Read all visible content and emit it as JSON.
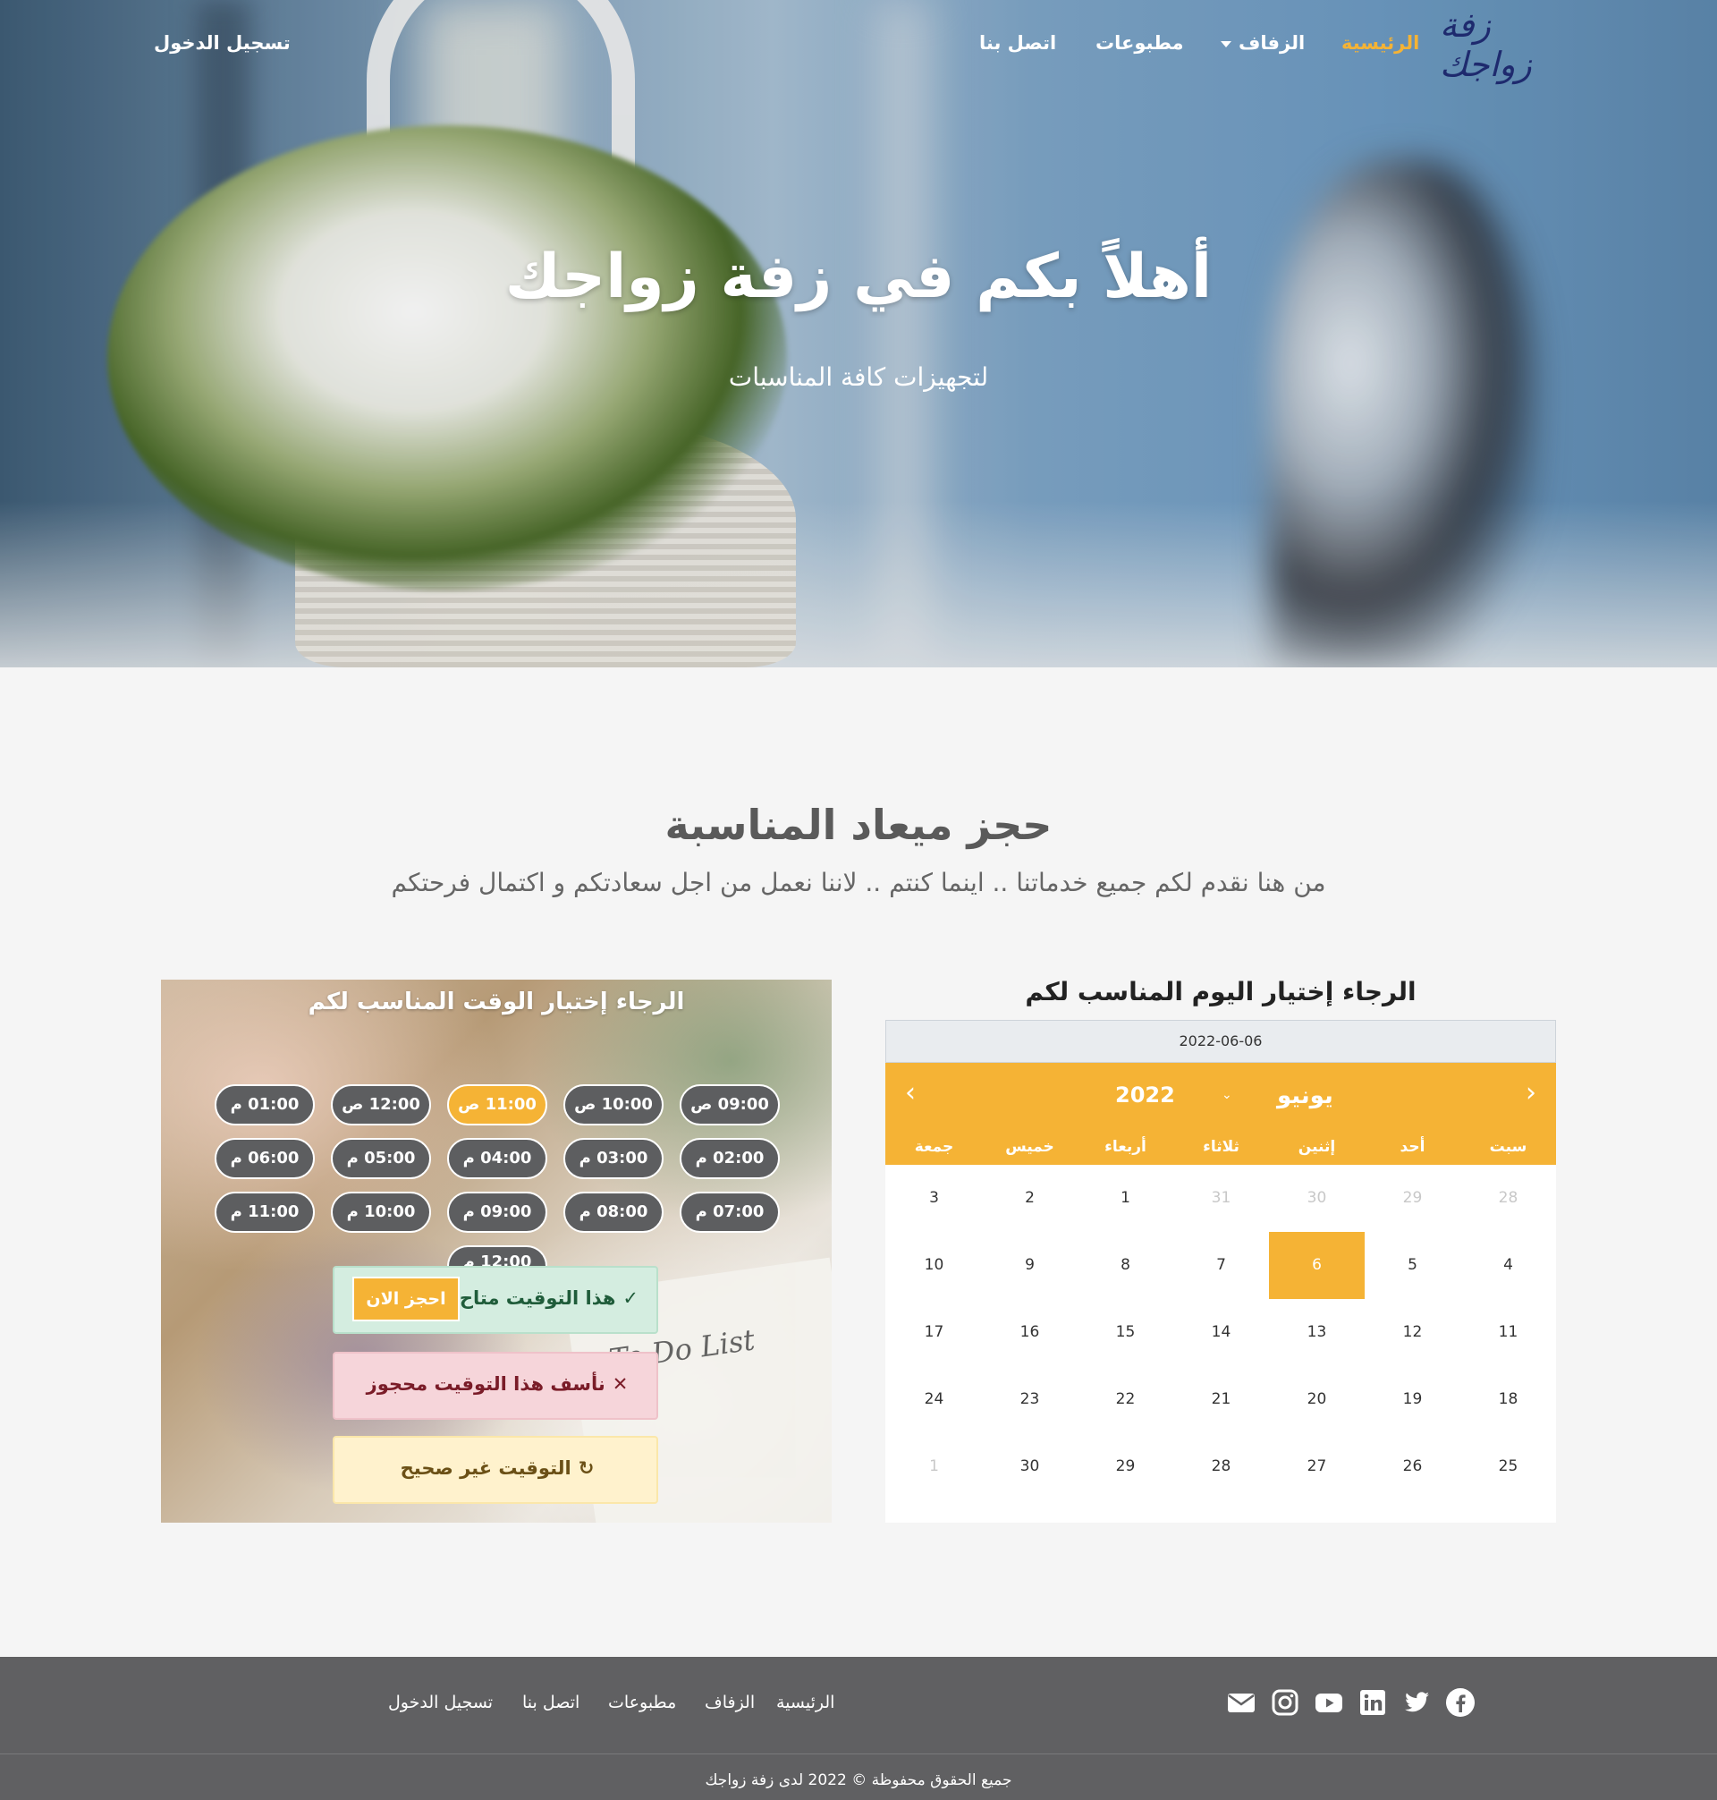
{
  "nav": {
    "logo": "زفة زواجك",
    "home": "الرئيسية",
    "wedding": "الزفاف",
    "prints": "مطبوعات",
    "contact": "اتصل بنا",
    "login": "تسجيل الدخول"
  },
  "hero": {
    "title": "أهلاً بكم في زفة زواجك",
    "subtitle": "لتجهيزات كافة المناسبات"
  },
  "booking": {
    "title": "حجز ميعاد المناسبة",
    "subtitle": "من هنا نقدم لكم جميع خدماتنا .. اينما كنتم .. لاننا نعمل من اجل سعادتكم و اكتمال فرحتكم",
    "times_title": "الرجاء إختيار الوقت المناسب لكم",
    "slots": [
      "09:00 ص",
      "10:00 ص",
      "11:00 ص",
      "12:00 ص",
      "01:00 م",
      "02:00 م",
      "03:00 م",
      "04:00 م",
      "05:00 م",
      "06:00 م",
      "07:00 م",
      "08:00 م",
      "09:00 م",
      "10:00 م",
      "11:00 م",
      "12:00 م"
    ],
    "selected_slot": "11:00 ص",
    "alert_available": "هذا التوقيت متاح",
    "book_now": "احجز الان",
    "alert_booked": "نأسف هذا التوقيت محجوز",
    "alert_invalid": "التوقيت غير صحيح",
    "notebook_text": "To Do List"
  },
  "calendar": {
    "title": "الرجاء إختيار اليوم المناسب لكم",
    "selected_date": "2022-06-06",
    "month": "يونيو",
    "year": "2022",
    "weekdays": [
      "سبت",
      "أحد",
      "إثنين",
      "ثلاثاء",
      "أربعاء",
      "خميس",
      "جمعة"
    ],
    "weeks": [
      [
        "28",
        "29",
        "30",
        "31",
        "1",
        "2",
        "3"
      ],
      [
        "4",
        "5",
        "6",
        "7",
        "8",
        "9",
        "10"
      ],
      [
        "11",
        "12",
        "13",
        "14",
        "15",
        "16",
        "17"
      ],
      [
        "18",
        "19",
        "20",
        "21",
        "22",
        "23",
        "24"
      ],
      [
        "25",
        "26",
        "27",
        "28",
        "29",
        "30",
        "1"
      ]
    ],
    "muted": [
      [
        0,
        0
      ],
      [
        0,
        1
      ],
      [
        0,
        2
      ],
      [
        0,
        3
      ],
      [
        4,
        6
      ]
    ],
    "selected_cell": [
      1,
      2
    ]
  },
  "footer": {
    "links": [
      "الرئيسية",
      "الزفاف",
      "مطبوعات",
      "اتصل بنا",
      "تسجيل الدخول"
    ],
    "social_icons": [
      "facebook-icon",
      "twitter-icon",
      "linkedin-icon",
      "youtube-icon",
      "instagram-icon",
      "envelope-icon"
    ],
    "copyright": "جميع الحقوق محفوظة © 2022 لدى زفة زواجك"
  },
  "colors": {
    "accent": "#f5b335",
    "slot_bg": "#5d5e60",
    "footer_bg": "#606062"
  }
}
